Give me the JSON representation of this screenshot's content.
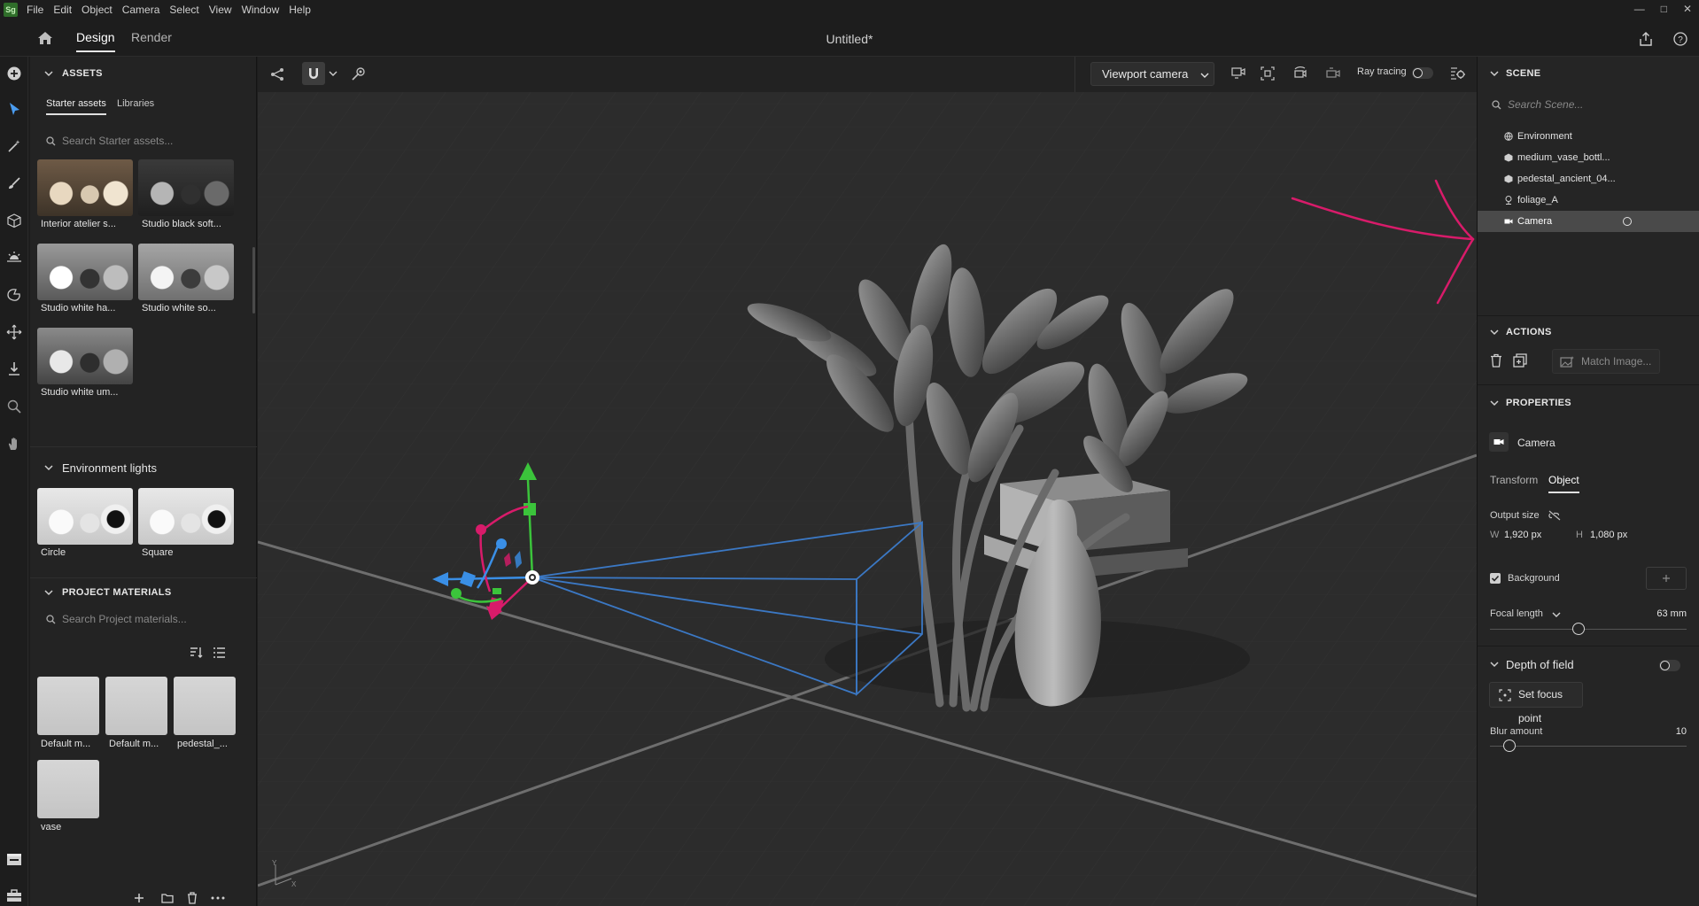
{
  "menubar": {
    "logo": "Sg",
    "items": [
      "File",
      "Edit",
      "Object",
      "Camera",
      "Select",
      "View",
      "Window",
      "Help"
    ]
  },
  "tabs": {
    "design": "Design",
    "render": "Render"
  },
  "document_title": "Untitled*",
  "assets": {
    "header": "ASSETS",
    "tabs": [
      "Starter assets",
      "Libraries"
    ],
    "search_placeholder": "Search Starter assets...",
    "items": [
      "Interior atelier s...",
      "Studio black soft...",
      "Studio white ha...",
      "Studio white so...",
      "Studio white um..."
    ],
    "env_lights_header": "Environment lights",
    "env_lights": [
      "Circle",
      "Square"
    ]
  },
  "project_materials": {
    "header": "PROJECT MATERIALS",
    "search_placeholder": "Search Project materials...",
    "items": [
      "Default m...",
      "Default m...",
      "pedestal_...",
      "vase"
    ]
  },
  "viewport": {
    "camera_select": "Viewport camera",
    "ray_tracing_label": "Ray tracing",
    "ray_tracing_on": false,
    "axis_y": "Y",
    "axis_x": "X"
  },
  "scene": {
    "header": "SCENE",
    "search_placeholder": "Search Scene...",
    "items": [
      "Environment",
      "medium_vase_bottl...",
      "pedestal_ancient_04...",
      "foliage_A",
      "Camera"
    ],
    "selected": "Camera"
  },
  "actions": {
    "header": "ACTIONS",
    "match_image": "Match Image..."
  },
  "properties": {
    "header": "PROPERTIES",
    "object_name": "Camera",
    "tabs": [
      "Transform",
      "Object"
    ],
    "active_tab": "Object",
    "output_size_label": "Output size",
    "width_label": "W",
    "width_value": "1,920 px",
    "height_label": "H",
    "height_value": "1,080 px",
    "background_label": "Background",
    "background_checked": true,
    "focal_length_label": "Focal length",
    "focal_length_value": "63 mm",
    "focal_length_fraction": 0.45,
    "depth_of_field_label": "Depth of field",
    "depth_of_field_on": false,
    "set_focus_point": "Set focus point",
    "blur_amount_label": "Blur amount",
    "blur_amount_value": "10",
    "blur_amount_fraction": 0.1
  },
  "colors": {
    "accent_pink": "#d81b6a",
    "gizmo_green": "#3bc43b",
    "gizmo_blue": "#3a8fe6",
    "frustum_blue": "#3b78c4"
  }
}
